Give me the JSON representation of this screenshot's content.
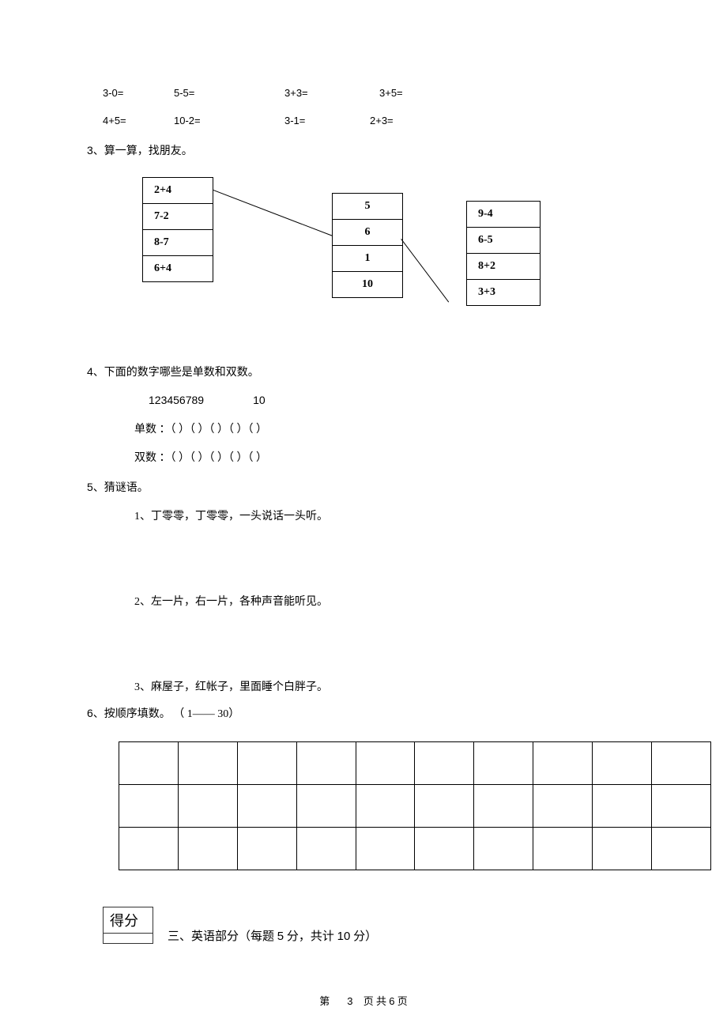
{
  "arithmetic": {
    "row1": {
      "c1": "3-0=",
      "c2": "5-5=",
      "c3": "3+3=",
      "c4": "3+5="
    },
    "row2": {
      "c1": "4+5=",
      "c2": "10-2=",
      "c3": "3-1=",
      "c4": "2+3="
    }
  },
  "q3": {
    "num": "3、",
    "text": "算一算，找朋友。",
    "left": [
      "2+4",
      "7-2",
      "8-7",
      "6+4"
    ],
    "mid": [
      "5",
      "6",
      "1",
      "10"
    ],
    "right": [
      "9-4",
      "6-5",
      "8+2",
      "3+3"
    ]
  },
  "q4": {
    "num": "4、",
    "text": "下面的数字哪些是单数和双数。",
    "digits": "123456789",
    "ten": "10",
    "odd_label": "单数 ：（   ）（    ）（    ）（   ）（   ）",
    "even_label": "双数 ：（   ）（    ）（    ）（   ）（    ）"
  },
  "q5": {
    "num": "5、",
    "text": "猜谜语。",
    "r1": "1、丁零零，丁零零，一头说话一头听。",
    "r2": "2、左一片，右一片，各种声音能听见。",
    "r3": "3、麻屋子，红帐子，里面睡个白胖子。"
  },
  "q6": {
    "num": "6、",
    "text": "按顺序填数。 （ 1—— 30）"
  },
  "score": {
    "label": "得分"
  },
  "section3": {
    "text_a": "三、英语部分（每题 ",
    "five": "5",
    "text_b": " 分，共计 ",
    "ten": "10",
    "text_c": " 分）"
  },
  "footer": {
    "prefix": "第",
    "page": "3",
    "suffix_a": " 页 共 ",
    "total": "6",
    "suffix_b": " 页"
  }
}
